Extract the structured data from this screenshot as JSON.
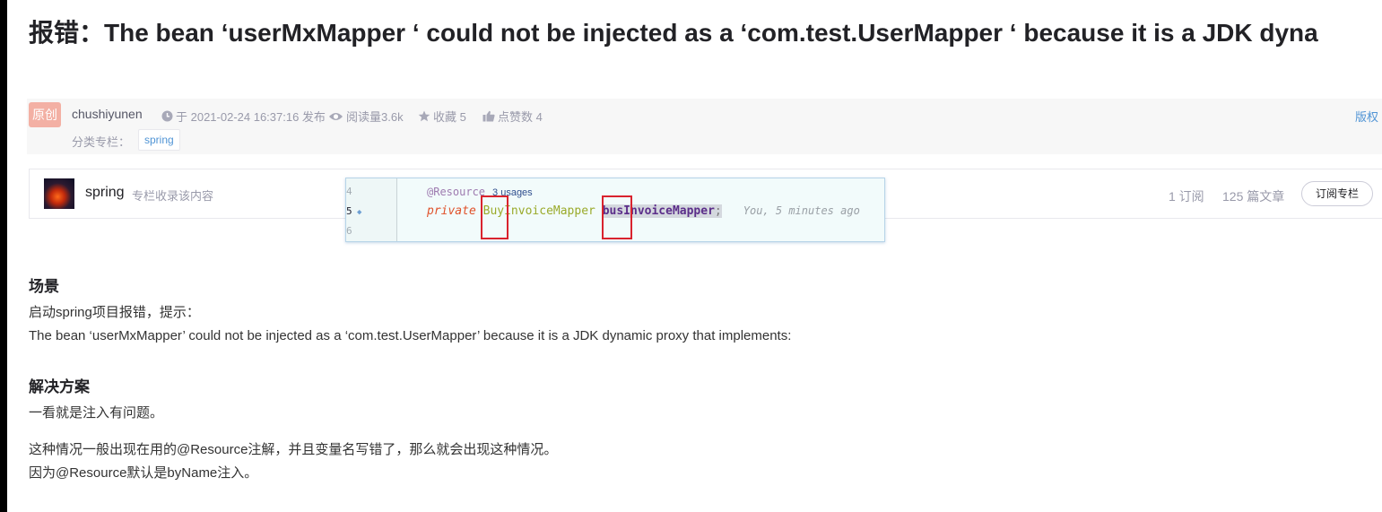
{
  "article": {
    "title": "报错：The bean ‘userMxMapper ‘ could not be injected as a ‘com.test.UserMapper ‘ because it is a JDK dyna"
  },
  "meta": {
    "badge": "原创",
    "author": "chushiyunen",
    "publish_time": "于 2021-02-24 16:37:16 发布",
    "reads": "阅读量3.6k",
    "favorites": "收藏 5",
    "likes": "点赞数 4",
    "copyright": "版权",
    "category_label": "分类专栏：",
    "category_tag": "spring"
  },
  "column": {
    "name": "spring",
    "description": "专栏收录该内容",
    "subscribers": "1 订阅",
    "articles": "125 篇文章",
    "subscribe_button": "订阅专栏"
  },
  "code_screenshot": {
    "line_numbers": [
      "4",
      "5",
      "6"
    ],
    "annotation": "@Resource",
    "usages": "3 usages",
    "keyword": "private",
    "type_name": "BuyInvoiceMapper",
    "variable_name": "busInvoiceMapper",
    "semicolon": ";",
    "blame": "You, 5 minutes ago"
  },
  "content": {
    "section1_heading": "场景",
    "section1_line1": "启动spring项目报错，提示：",
    "section1_line2": "The bean ‘userMxMapper’ could not be injected as a ‘com.test.UserMapper’ because it is a JDK dynamic proxy that implements:",
    "section2_heading": "解决方案",
    "section2_line1": "一看就是注入有问题。",
    "section2_line2": "这种情况一般出现在用的@Resource注解，并且变量名写错了，那么就会出现这种情况。",
    "section2_line3": "因为@Resource默认是byName注入。"
  },
  "colors": {
    "badge_bg": "#f3b0a4",
    "link_blue": "#5094d5",
    "highlight_red": "#d9232e"
  }
}
